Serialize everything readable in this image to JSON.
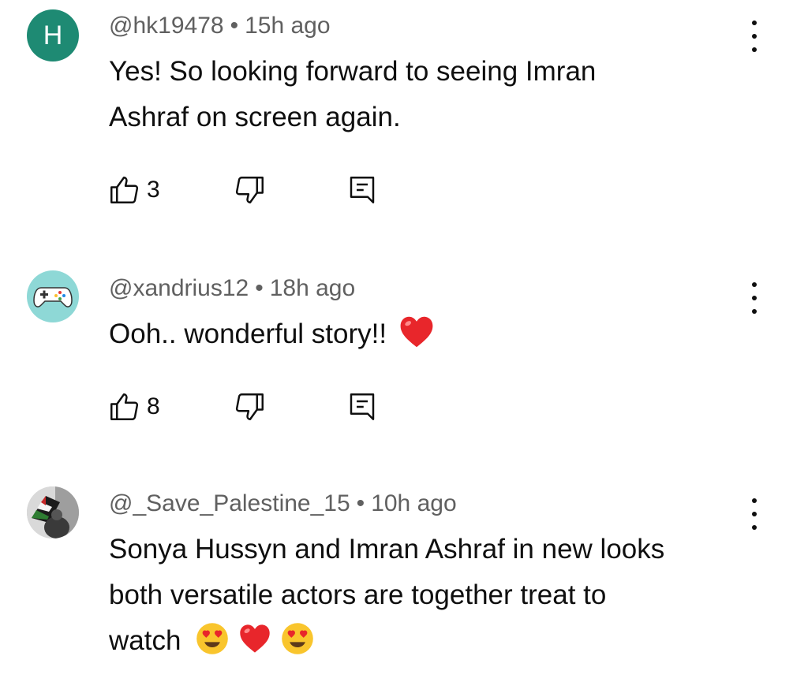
{
  "comments": [
    {
      "avatar_letter": "H",
      "avatar_color": "#1e8a73",
      "handle": "@hk19478",
      "separator": "•",
      "time": "15h ago",
      "text_lines": [
        "Yes! So looking forward to seeing Imran",
        "Ashraf on screen again."
      ],
      "likes": "3"
    },
    {
      "avatar_icon": "gamepad-icon",
      "avatar_color": "#8ed8d6",
      "handle": "@xandrius12",
      "separator": "•",
      "time": "18h ago",
      "text": "Ooh.. wonderful story!!",
      "emoji": [
        "red-heart-icon"
      ],
      "likes": "8"
    },
    {
      "avatar_icon": "flag-photo-avatar",
      "handle": "@_Save_Palestine_15",
      "separator": "•",
      "time": "10h ago",
      "text_lines": [
        "Sonya Hussyn and Imran Ashraf in new looks",
        "both versatile actors are together treat to",
        "watch"
      ],
      "emoji": [
        "heart-eyes-icon",
        "red-heart-icon",
        "heart-eyes-icon"
      ]
    }
  ],
  "colors": {
    "text": "#0f0f0f",
    "meta": "#606060",
    "heart": "#e8262b",
    "emoji_face": "#f9c52d"
  }
}
